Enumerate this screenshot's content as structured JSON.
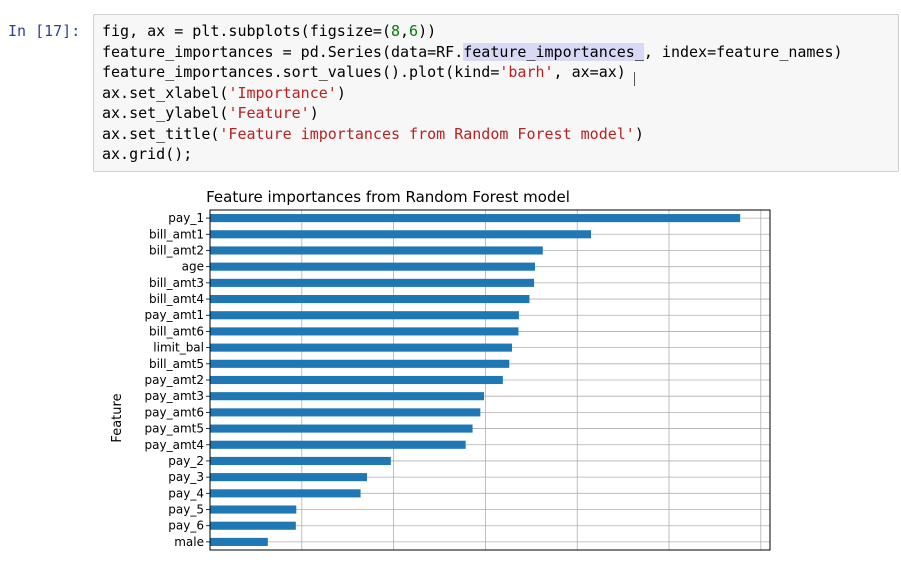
{
  "cell": {
    "prompt": "In [17]:",
    "code_lines": [
      [
        {
          "t": "fig, ax = plt.subplots(figsize=("
        },
        {
          "t": "8",
          "c": "num"
        },
        {
          "t": ","
        },
        {
          "t": "6",
          "c": "num"
        },
        {
          "t": "))"
        }
      ],
      [
        {
          "t": "feature_importances = pd.Series(data=RF."
        },
        {
          "t": "feature_importances_",
          "c": "sel"
        },
        {
          "t": ", index=feature_names)"
        }
      ],
      [
        {
          "t": "feature_importances.sort_values().plot(kind="
        },
        {
          "t": "'barh'",
          "c": "str"
        },
        {
          "t": ", ax=ax)"
        }
      ],
      [
        {
          "t": "ax.set_xlabel("
        },
        {
          "t": "'Importance'",
          "c": "str"
        },
        {
          "t": ")"
        }
      ],
      [
        {
          "t": "ax.set_ylabel("
        },
        {
          "t": "'Feature'",
          "c": "str"
        },
        {
          "t": ")"
        }
      ],
      [
        {
          "t": "ax.set_title("
        },
        {
          "t": "'Feature importances from Random Forest model'",
          "c": "str"
        },
        {
          "t": ")"
        }
      ],
      [
        {
          "t": "ax.grid();"
        }
      ]
    ]
  },
  "chart_data": {
    "type": "bar",
    "orientation": "horizontal",
    "title": "Feature importances from Random Forest model",
    "xlabel": "",
    "ylabel": "Feature",
    "grid": true,
    "xlim": [
      0,
      0.122
    ],
    "bar_color": "#1f77b4",
    "categories": [
      "pay_1",
      "bill_amt1",
      "bill_amt2",
      "age",
      "bill_amt3",
      "bill_amt4",
      "pay_amt1",
      "bill_amt6",
      "limit_bal",
      "bill_amt5",
      "pay_amt2",
      "pay_amt3",
      "pay_amt6",
      "pay_amt5",
      "pay_amt4",
      "pay_2",
      "pay_3",
      "pay_4",
      "pay_5",
      "pay_6",
      "male"
    ],
    "values": [
      0.1155,
      0.083,
      0.0725,
      0.0708,
      0.0706,
      0.0696,
      0.0673,
      0.0672,
      0.0658,
      0.0652,
      0.0638,
      0.0597,
      0.0589,
      0.0572,
      0.0557,
      0.0394,
      0.0342,
      0.0328,
      0.0188,
      0.0187,
      0.0126
    ]
  }
}
